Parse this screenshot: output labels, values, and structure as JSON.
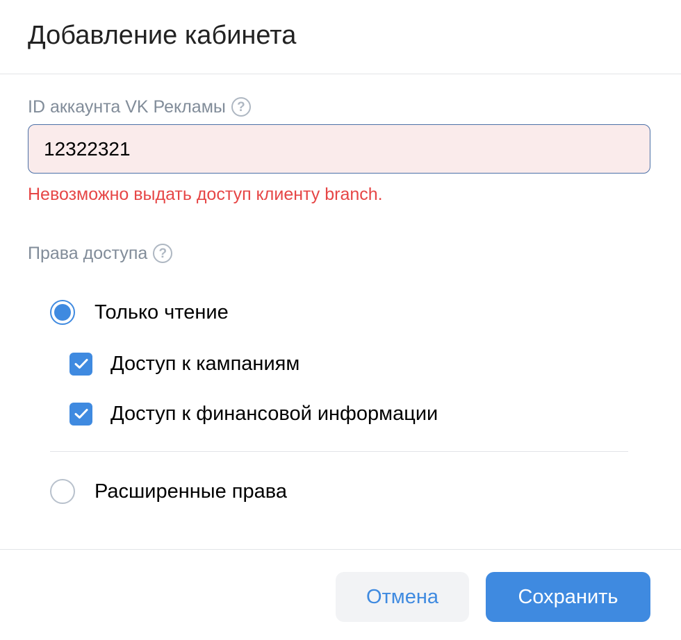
{
  "dialog": {
    "title": "Добавление кабинета"
  },
  "account_field": {
    "label": "ID аккаунта VK Рекламы",
    "help_icon": "question-circle-icon",
    "value": "12322321",
    "error": "Невозможно выдать доступ клиенту branch."
  },
  "rights": {
    "label": "Права доступа",
    "help_icon": "question-circle-icon",
    "options": [
      {
        "label": "Только чтение",
        "selected": true
      },
      {
        "label": "Расширенные права",
        "selected": false
      }
    ],
    "checkboxes": [
      {
        "label": "Доступ к кампаниям",
        "checked": true
      },
      {
        "label": "Доступ к финансовой информации",
        "checked": true
      }
    ]
  },
  "footer": {
    "cancel_label": "Отмена",
    "save_label": "Сохранить"
  },
  "colors": {
    "accent": "#3f8ae0",
    "error": "#e64646",
    "input_error_bg": "#faebeb",
    "secondary_text": "#818c99"
  }
}
